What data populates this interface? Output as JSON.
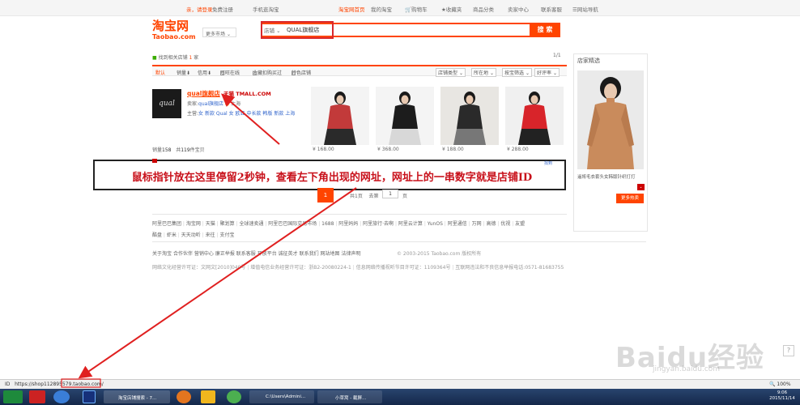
{
  "topbar": {
    "login_hint": "亲，请登录",
    "register": "免费注册",
    "mobile": "手机逛淘宝",
    "home": "淘宝网首页",
    "my_taobao": "我的淘宝",
    "cart": "购物车",
    "favorites": "收藏夹",
    "categories": "商品分类",
    "seller": "卖家中心",
    "service": "联系客服",
    "sitemap": "网站导航"
  },
  "header": {
    "logo_cn": "淘宝网",
    "logo_en": "Taobao.com",
    "more_market": "更多市场"
  },
  "search": {
    "type": "店铺",
    "value": "QUAL旗舰店",
    "button": "搜 索"
  },
  "results": {
    "found_prefix": "找到相关店铺",
    "found_count": "1",
    "found_suffix": "家",
    "page": "1/1"
  },
  "filters": {
    "default": "默认",
    "sales": "销量",
    "credit": "信用",
    "wangwang": "旺旺在线",
    "guarantee": "收藏扣购买过",
    "special": "特色店铺",
    "shop_type": "店铺类型",
    "location": "所在地",
    "filter": "按宝筛选",
    "rating": "好评率"
  },
  "shop": {
    "logo_text": "qual",
    "name": "qual旗舰店",
    "tmall": "天猫 TMALL.COM",
    "seller_label": "卖家:",
    "seller": "qual旗舰店",
    "location": "上海",
    "main_label": "主营:",
    "main_items": [
      "女 新款",
      "Qual 女",
      "欧亚",
      "中长款",
      "韩版",
      "新款",
      "上海"
    ],
    "sales_label": "销量",
    "sales": "158",
    "items_label": "共",
    "items": "119",
    "items_suffix": "件宝贝"
  },
  "products": [
    {
      "price": "¥ 168.00",
      "colors": [
        "#f4f4f4",
        "#c23a3a",
        "#2a2a2a"
      ]
    },
    {
      "price": "¥ 368.00",
      "colors": [
        "#f4f4f4",
        "#1c1c1c",
        "#d8d8d8"
      ]
    },
    {
      "price": "¥ 188.00",
      "colors": [
        "#e8e6e2",
        "#2a2a2a",
        "#777"
      ]
    },
    {
      "price": "¥ 288.00",
      "colors": [
        "#f0f0f0",
        "#d8242a",
        "#222"
      ]
    }
  ],
  "callout": {
    "text": "鼠标指针放在这里停留2秒钟，查看左下角出现的网址，网址上的一串数字就是店铺ID",
    "tag": "找到"
  },
  "pagination": {
    "current": "1",
    "total": "共1页",
    "goto": "去第",
    "input": "1",
    "unit": "页"
  },
  "footer": {
    "row1": [
      "阿里巴巴集团",
      "淘宝网",
      "天猫",
      "聚划算",
      "全球速卖通",
      "阿里巴巴国际交易市场",
      "1688",
      "阿里妈妈",
      "阿里旅行·去啊",
      "阿里云计算",
      "YunOS",
      "阿里通信",
      "万网",
      "高德",
      "优视",
      "友盟"
    ],
    "row2": [
      "酷盘",
      "虾米",
      "天天动听",
      "来往",
      "支付宝"
    ],
    "row3": [
      "关于淘宝",
      "合作伙伴",
      "营销中心",
      "廉正举报",
      "联系客服",
      "开放平台",
      "诚征英才",
      "联系我们",
      "网站地图",
      "法律声明"
    ],
    "copyright": "© 2003-2015 Taobao.com 版权所有",
    "row4": [
      "网络文化经营许可证：文网文[2010]040号",
      "增值电信业务经营许可证：浙B2-20080224-1",
      "信息网络传播视听节目许可证：1109364号",
      "互联网违法和不良信息举报电话:0571-81683755"
    ]
  },
  "sidebar": {
    "title": "店家精选",
    "caption": "遥将毛衣套头女韩版针织打打",
    "more": "更多热卖"
  },
  "statusbar": {
    "id_label": "ID",
    "url": "https://shop112895579.taobao.com/",
    "zoom": "100%"
  },
  "taskbar": {
    "task1": "淘宝店铺搜索 - 7...",
    "task2": "C:\\Users\\Admini...",
    "task3": "小草窝 - 截屏...",
    "time": "9:06",
    "date": "2015/11/14"
  },
  "watermark": {
    "main": "Baidu经验",
    "sub": "jingyan.baidu.com",
    "q": "?"
  },
  "colors": {
    "accent": "#ff4400",
    "annotation_red": "#d9282b"
  }
}
